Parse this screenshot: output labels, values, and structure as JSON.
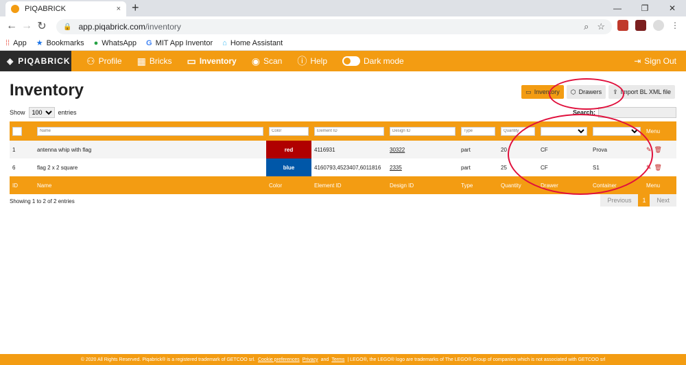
{
  "browser": {
    "tab_title": "PIQABRICK",
    "tab_close": "×",
    "new_tab": "+",
    "window_controls": [
      "—",
      "❐",
      "✕"
    ],
    "url_host": "app.piqabrick.com",
    "url_path": "/inventory",
    "bookmarks": [
      {
        "icon": "apps-icon",
        "label": "App"
      },
      {
        "icon": "star-icon",
        "label": "Bookmarks"
      },
      {
        "icon": "whatsapp-icon",
        "label": "WhatsApp"
      },
      {
        "icon": "google-icon",
        "label": "MIT App Inventor"
      },
      {
        "icon": "home-assistant-icon",
        "label": "Home Assistant"
      }
    ]
  },
  "nav": {
    "brand": "PIQABRICK",
    "items": [
      {
        "label": "Profile",
        "icon": "person-icon"
      },
      {
        "label": "Bricks",
        "icon": "grid-icon"
      },
      {
        "label": "Inventory",
        "icon": "archive-icon",
        "active": true
      },
      {
        "label": "Scan",
        "icon": "eye-icon"
      },
      {
        "label": "Help",
        "icon": "question-icon"
      }
    ],
    "dark_mode_label": "Dark mode",
    "sign_out": "Sign Out"
  },
  "page": {
    "title": "Inventory",
    "buttons": {
      "inventory": "Inventory",
      "drawers": "Drawers",
      "import": "Import BL XML file"
    },
    "show_label": "Show",
    "entries_value": "100",
    "entries_label": "entries",
    "search_label": "Search:"
  },
  "table": {
    "filters": {
      "name": "Name",
      "color": "Color",
      "element_id": "Element ID",
      "design_id": "Design ID",
      "type": "Type",
      "quantity": "Quantity",
      "menu": "Menu"
    },
    "columns": [
      "ID",
      "Name",
      "Color",
      "Element ID",
      "Design ID",
      "Type",
      "Quantity",
      "Drawer",
      "Container",
      "Menu"
    ],
    "rows": [
      {
        "id": "1",
        "name": "antenna whip with flag",
        "color": "red",
        "color_hex": "#b00000",
        "element_id": "4116931",
        "design_id": "30322",
        "type": "part",
        "quantity": "20",
        "drawer": "CF",
        "container": "Prova"
      },
      {
        "id": "6",
        "name": "flag 2 x 2 square",
        "color": "blue",
        "color_hex": "#0057a8",
        "element_id": "4160793,4523407,6011816",
        "design_id": "2335",
        "type": "part",
        "quantity": "25",
        "drawer": "CF",
        "container": "S1"
      }
    ]
  },
  "info": "Showing 1 to 2 of 2 entries",
  "pager": {
    "previous": "Previous",
    "current": "1",
    "next": "Next"
  },
  "footer": {
    "prefix": "© 2020 All Rights Reserved. Piqabrick® is a registered trademark of GETCOO srl.",
    "cookie": "Cookie preferences",
    "privacy": "Privacy",
    "and": "and",
    "terms": "Terms",
    "suffix": "| LEGO®, the LEGO® logo are trademarks of The LEGO® Group of companies which is not associated with GETCOO srl"
  },
  "colors": {
    "accent": "#f39c12",
    "brand_bg": "#2b2b2b",
    "annotation": "#e0103c"
  }
}
